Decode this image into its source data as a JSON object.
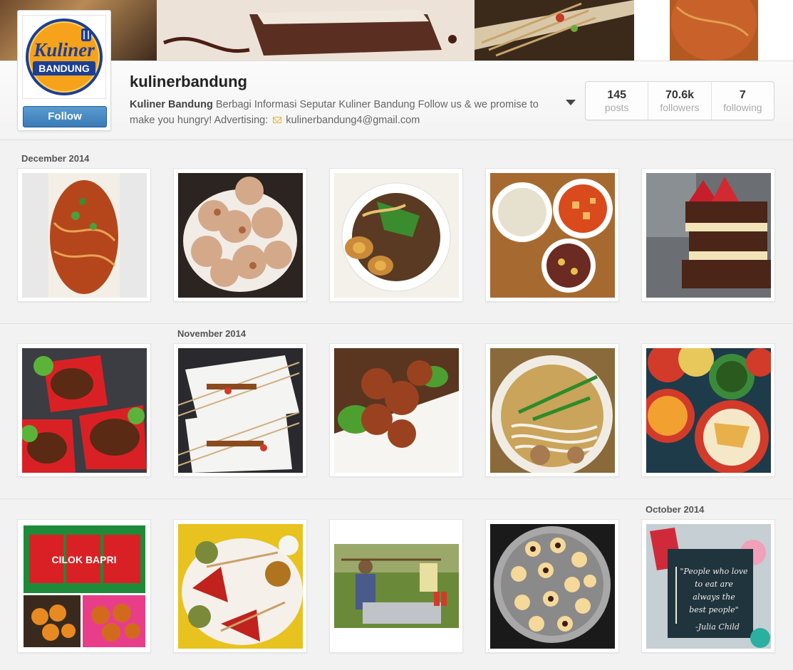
{
  "profile": {
    "username": "kulinerbandung",
    "display_name": "Kuliner Bandung",
    "bio": "Berbagi Informasi Seputar Kuliner Bandung Follow us & we promise to make you hungry! Advertising:",
    "email": "kulinerbandung4@gmail.com",
    "follow_label": "Follow",
    "logo_line1": "Kuliner",
    "logo_line2": "BANDUNG"
  },
  "stats": [
    {
      "value": "145",
      "label": "posts"
    },
    {
      "value": "70.6k",
      "label": "followers"
    },
    {
      "value": "7",
      "label": "following"
    }
  ],
  "months": {
    "december": "December 2014",
    "november": "November 2014",
    "october": "October 2014"
  },
  "quote": {
    "line1": "\"People who love",
    "line2": "to eat are",
    "line3": "always the",
    "line4": "best people\"",
    "line5": "-Julia Child"
  },
  "signs": {
    "sign1": "CILOK BAPRI"
  },
  "colors": {
    "follow_button": "#3a7bb6",
    "logo_orange": "#f7a21b",
    "logo_blue": "#1c3f94",
    "background": "#f2f2f2"
  },
  "icons": {
    "dropdown": "chevron-down-icon",
    "email": "mail-icon"
  }
}
